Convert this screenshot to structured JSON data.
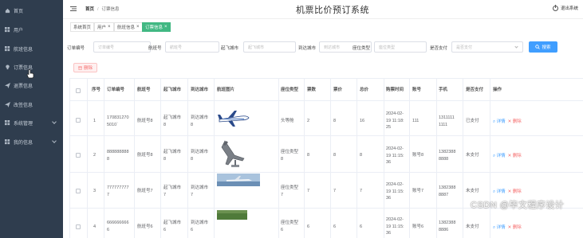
{
  "sidebar": {
    "items": [
      {
        "label": "首页",
        "icon": "home-icon"
      },
      {
        "label": "用户",
        "icon": "grid-icon"
      },
      {
        "label": "航班信息",
        "icon": "grid-icon"
      },
      {
        "label": "订票信息",
        "icon": "bulb-icon"
      },
      {
        "label": "退票信息",
        "icon": "send-icon"
      },
      {
        "label": "改签信息",
        "icon": "send-icon"
      },
      {
        "label": "系统管理",
        "icon": "grid-icon"
      },
      {
        "label": "我的信息",
        "icon": "grid-icon"
      }
    ]
  },
  "header": {
    "breadcrumb_home": "首页",
    "breadcrumb_current": "订票信息",
    "title": "机票比价预订系统",
    "logout": "退出系统"
  },
  "tabs": [
    {
      "label": "系统首页",
      "closable": false
    },
    {
      "label": "用户",
      "closable": true
    },
    {
      "label": "航班信息",
      "closable": true
    },
    {
      "label": "订票信息",
      "closable": true,
      "active": true
    }
  ],
  "filters": {
    "order_no_label": "订单编号",
    "order_no_placeholder": "订单编号",
    "flight_no_label": "航班号",
    "flight_no_placeholder": "航班号",
    "from_label": "起飞城市",
    "from_placeholder": "起飞城市",
    "to_label": "到达城市",
    "to_placeholder": "到达城市",
    "seat_label": "座位类型",
    "seat_placeholder": "座位类型",
    "paid_label": "是否支付",
    "paid_placeholder": "是否支付",
    "search_label": "搜索"
  },
  "delete_label": "删除",
  "table": {
    "headers": [
      "序号",
      "订单编号",
      "航班号",
      "起飞城市",
      "到达城市",
      "航班图片",
      "座位类型",
      "票数",
      "票价",
      "总价",
      "购票时间",
      "账号",
      "手机",
      "是否支付",
      "操作"
    ],
    "rows": [
      {
        "index": "1",
        "order_no": "170831270\n5010`",
        "flight": "航班号8",
        "from": "起飞城市\n8",
        "to": "到达城市\n8",
        "seat": "头等舱",
        "tickets": "2",
        "price": "8",
        "total": "16",
        "time": "2024-02-\n19 11:18:\n25",
        "account": "111",
        "phone": "1311111\n1111",
        "paid": "已支付",
        "image": "plane-white"
      },
      {
        "index": "2",
        "order_no": "888888888\n8",
        "flight": "航班号8",
        "from": "起飞城市\n8",
        "to": "到达城市\n8",
        "seat": "座位类型\n8",
        "tickets": "8",
        "price": "8",
        "total": "8",
        "time": "2024-02-\n19 11:15:\n36",
        "account": "账号8",
        "phone": "1382388\n8888",
        "paid": "未支付",
        "image": "jet-gray"
      },
      {
        "index": "3",
        "order_no": "777777777\n7",
        "flight": "航班号7",
        "from": "起飞城市\n7",
        "to": "到达城市\n7",
        "seat": "座位类型\n7",
        "tickets": "7",
        "price": "7",
        "total": "7",
        "time": "2024-02-\n19 11:15:\n36",
        "account": "账号7",
        "phone": "1382388\n8887",
        "paid": "未支付",
        "image": "plane-sky"
      },
      {
        "index": "4",
        "order_no": "666666666\n6",
        "flight": "航班号6",
        "from": "起飞城市\n6",
        "to": "到达城市\n6",
        "seat": "座位类型\n6",
        "tickets": "6",
        "price": "6",
        "total": "6",
        "time": "2024-02-\n19 11:15:\n36",
        "account": "账号6",
        "phone": "1382388\n8886",
        "paid": "未支付",
        "image": "grass"
      }
    ],
    "edit_label": "详情",
    "delete_label": "删除"
  },
  "watermark": "CSDN @毕文程序设计",
  "colors": {
    "sidebar": "#2f3d4e",
    "accent": "#409eff",
    "active_tab": "#41b883",
    "danger": "#f56c6c"
  }
}
